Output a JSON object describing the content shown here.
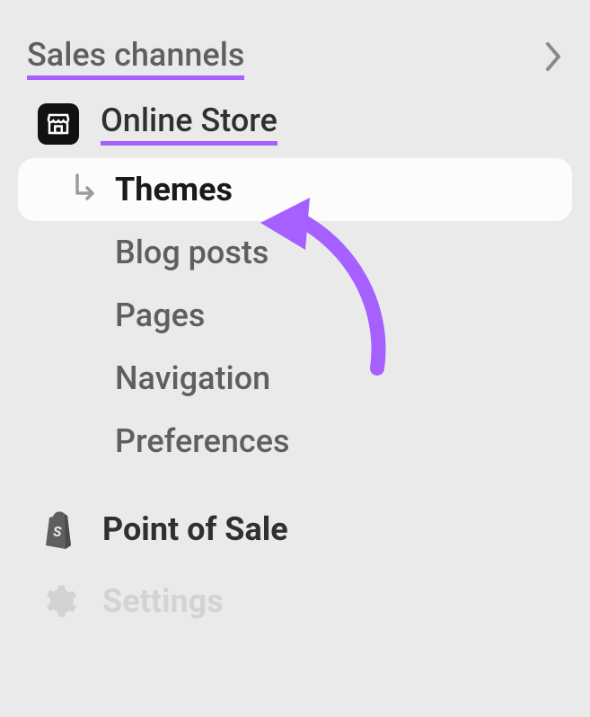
{
  "section": {
    "title": "Sales channels"
  },
  "channel": {
    "name": "Online Store",
    "subitems": [
      {
        "label": "Themes"
      },
      {
        "label": "Blog posts"
      },
      {
        "label": "Pages"
      },
      {
        "label": "Navigation"
      },
      {
        "label": "Preferences"
      }
    ]
  },
  "pos": {
    "label": "Point of Sale"
  },
  "settings": {
    "label": "Settings"
  }
}
